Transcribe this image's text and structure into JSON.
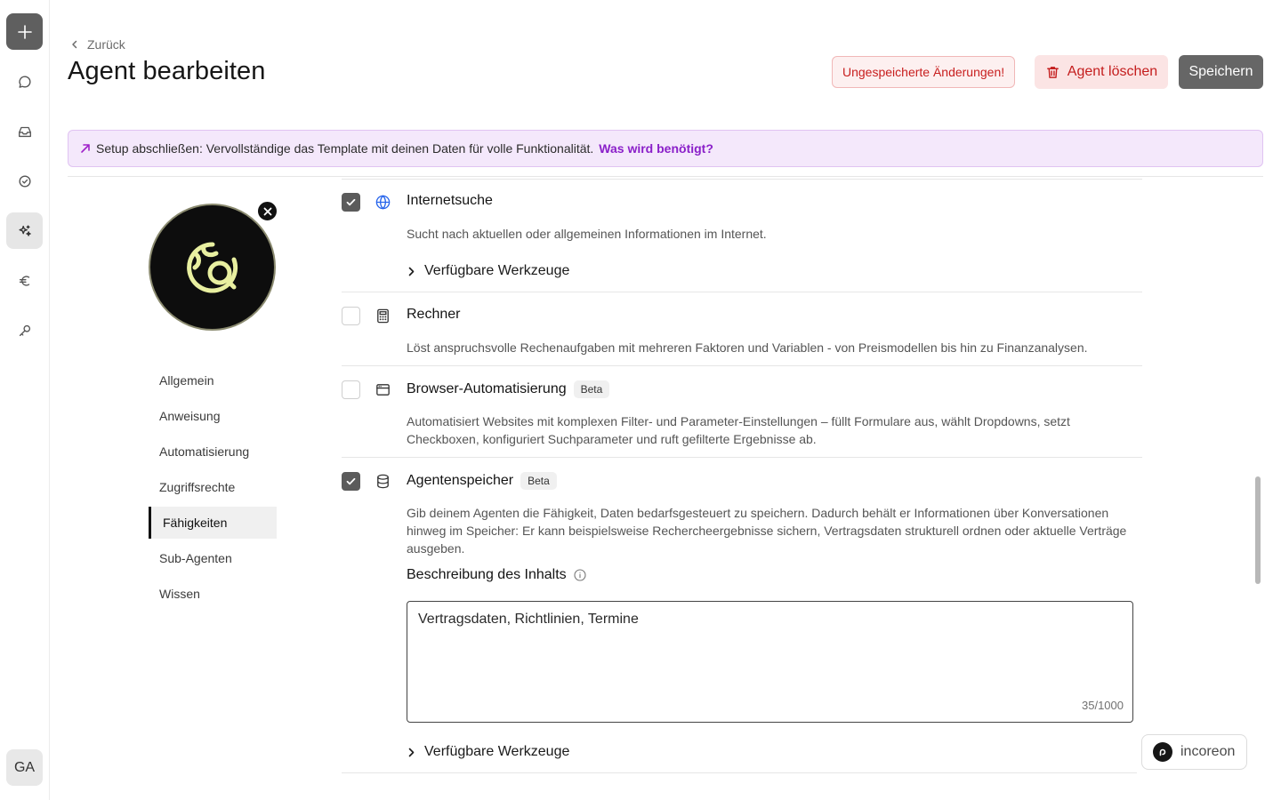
{
  "rail": {
    "new_icon": "plus-icon",
    "items": [
      "chat-icon",
      "inbox-icon",
      "tasks-icon",
      "agents-icon",
      "euro-icon",
      "key-icon"
    ],
    "avatar_initials": "GA"
  },
  "header": {
    "back_label": "Zurück",
    "title": "Agent bearbeiten",
    "unsaved_label": "Ungespeicherte Änderungen!",
    "delete_label": "Agent löschen",
    "save_label": "Speichern"
  },
  "banner": {
    "text": "Setup abschließen: Vervollständige das Template mit deinen Daten für volle Funktionalität.",
    "link": "Was wird benötigt?"
  },
  "nav": {
    "items": [
      "Allgemein",
      "Anweisung",
      "Automatisierung",
      "Zugriffsrechte",
      "Fähigkeiten",
      "Sub-Agenten",
      "Wissen"
    ],
    "active": "Fähigkeiten"
  },
  "capabilities": [
    {
      "title": "Internetsuche",
      "checked": true,
      "icon": "globe-icon",
      "description": "Sucht nach aktuellen oder allgemeinen Informationen im Internet.",
      "tools_label": "Verfügbare Werkzeuge"
    },
    {
      "title": "Rechner",
      "checked": false,
      "icon": "calculator-icon",
      "description": "Löst anspruchsvolle Rechenaufgaben mit mehreren Faktoren und Variablen - von Preismodellen bis hin zu Finanzanalysen."
    },
    {
      "title": "Browser-Automatisierung",
      "checked": false,
      "icon": "browser-icon",
      "badge": "Beta",
      "description": "Automatisiert Websites mit komplexen Filter- und Parameter-Einstellungen – füllt Formulare aus, wählt Dropdowns, setzt Checkboxen, konfiguriert Suchparameter und ruft gefilterte Ergebnisse ab."
    },
    {
      "title": "Agentenspeicher",
      "checked": true,
      "icon": "database-icon",
      "badge": "Beta",
      "description": "Gib deinem Agenten die Fähigkeit, Daten bedarfsgesteuert zu speichern. Dadurch behält er Informationen über Konversationen hinweg im Speicher: Er kann beispielsweise Rechercheergebnisse sichern, Vertragsdaten strukturell ordnen oder aktuelle Verträge ausgeben.",
      "field_label": "Beschreibung des Inhalts",
      "field_value": "Vertragsdaten, Richtlinien, Termine",
      "counter": "35/1000",
      "tools_label": "Verfügbare Werkzeuge"
    }
  ],
  "brand": {
    "name": "incoreon"
  },
  "colors": {
    "accent": "#8a1fc9",
    "danger": "#c41d1d",
    "banner_bg": "#f4e8fb"
  }
}
